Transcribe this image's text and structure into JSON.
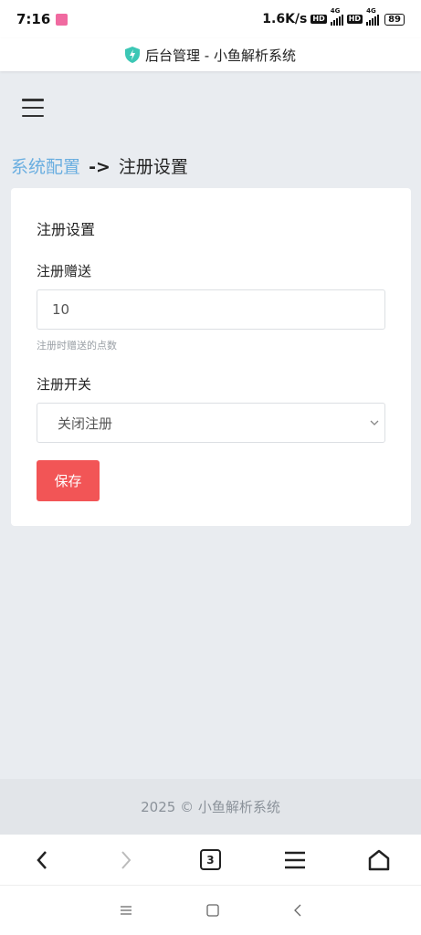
{
  "status_bar": {
    "time": "7:16",
    "network_speed": "1.6K/s",
    "hd1": "HD",
    "hd2": "HD",
    "net1": "4G",
    "net2": "4G",
    "battery": "89"
  },
  "title_bar": {
    "title": "后台管理 - 小鱼解析系统",
    "shield_color": "#3cc7b5"
  },
  "breadcrumb": {
    "parent": "系统配置",
    "separator": "->",
    "current": "注册设置"
  },
  "card": {
    "title": "注册设置",
    "gift_label": "注册赠送",
    "gift_value": "10",
    "gift_help": "注册时赠送的点数",
    "switch_label": "注册开关",
    "switch_value": "关闭注册",
    "save_label": "保存"
  },
  "footer": {
    "text": "2025 © 小鱼解析系统"
  },
  "browser_nav": {
    "tab_count": "3"
  },
  "colors": {
    "accent": "#f25556",
    "link": "#6aaee0",
    "background": "#e9ecf0"
  }
}
